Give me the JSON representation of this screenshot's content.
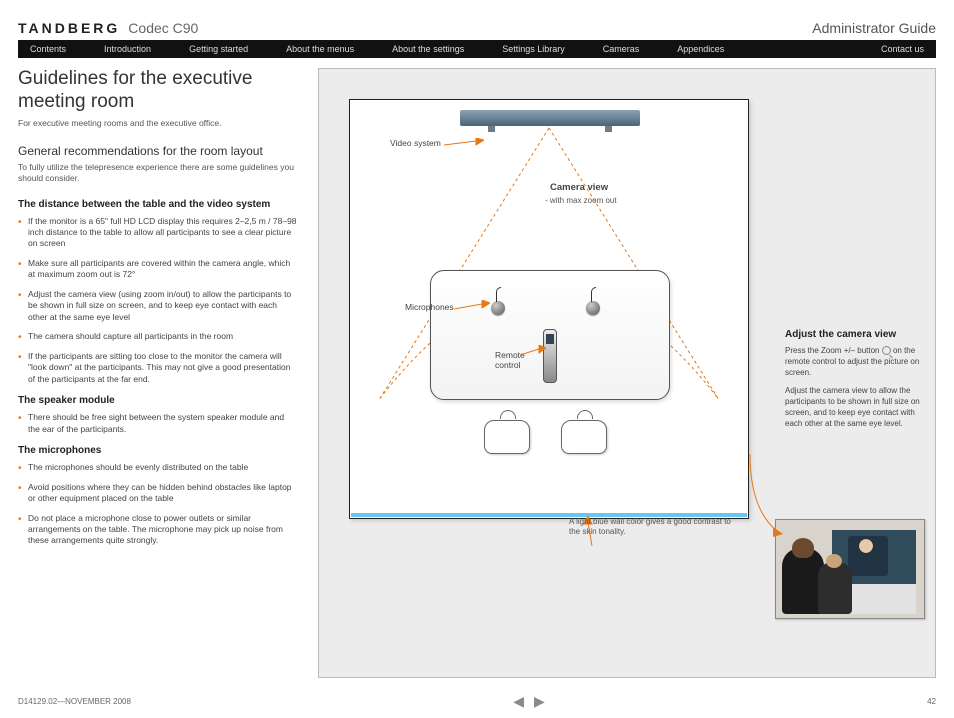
{
  "header": {
    "brand": "TANDBERG",
    "product": "Codec C90",
    "right": "Administrator Guide"
  },
  "nav": {
    "items": [
      "Contents",
      "Introduction",
      "Getting started",
      "About the menus",
      "About the settings",
      "Settings Library",
      "Cameras",
      "Appendices",
      "Contact us"
    ]
  },
  "left": {
    "title": "Guidelines for the executive meeting room",
    "sub": "For executive meeting rooms and the executive office.",
    "h2": "General recommendations for the room layout",
    "lead": "To fully utilize the telepresence experience there are some guidelines you should consider.",
    "s1": {
      "h": "The distance between the table and the video system",
      "items": [
        "If the monitor is a 65\" full HD LCD display this requires 2–2,5 m / 78–98 inch distance to the table to allow all participants to see a clear picture on screen",
        "Make sure all participants are covered within the camera angle, which at maximum zoom out is 72°",
        "Adjust the camera view (using zoom in/out) to allow the participants to be shown in full size on screen, and to keep eye contact with each other at the same eye level",
        "The camera should capture all participants in the room",
        "If the participants are sitting too close to the monitor the camera will \"look down\" at the participants. This may not give a good presentation of the participants at the far end."
      ]
    },
    "s2": {
      "h": "The speaker module",
      "items": [
        "There should be free sight between the system speaker module and the ear of the participants."
      ]
    },
    "s3": {
      "h": "The microphones",
      "items": [
        "The microphones should be evenly distributed on the table",
        "Avoid positions where they can be hidden behind obstacles like laptop or other equipment placed on the table",
        "Do not place a microphone close to power outlets or similar arrangements on the table. The microphone may pick up noise from these arrangements quite strongly."
      ]
    }
  },
  "diagram": {
    "video_system": "Video system",
    "camera_view": "Camera view",
    "camera_view_sub": "- with max zoom out",
    "microphones": "Microphones",
    "remote1": "Remote",
    "remote2": "control",
    "wall_note": "A light blue wall color gives a good contrast to the skin tonality."
  },
  "side": {
    "h": "Adjust the camera view",
    "p1a": "Press the Zoom +/– button ",
    "p1b": " on the remote control to adjust the picture on screen.",
    "p2": "Adjust the camera view to allow the participants to be shown in full size on screen, and to keep eye contact with each other at the same eye level."
  },
  "footer": {
    "doc": "D14129.02—NOVEMBER 2008",
    "page": "42"
  }
}
